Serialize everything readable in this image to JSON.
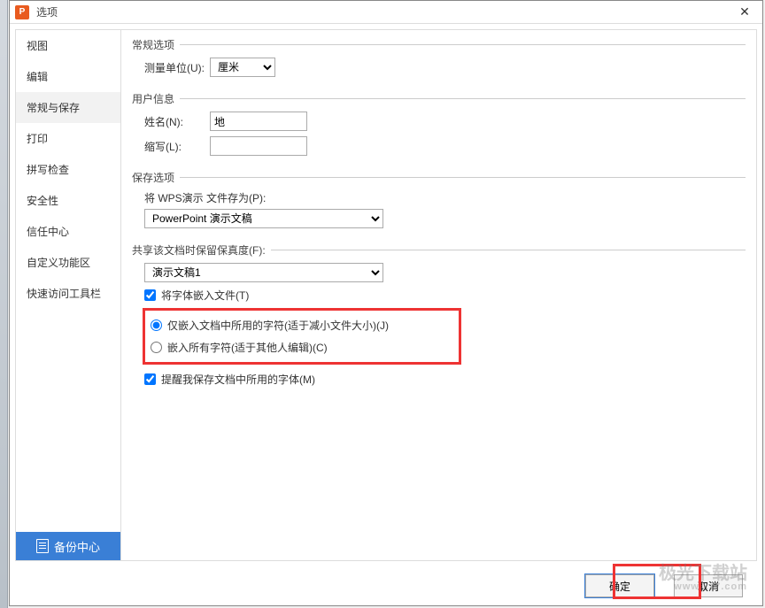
{
  "window": {
    "title": "选项"
  },
  "sidebar": {
    "items": [
      {
        "label": "视图"
      },
      {
        "label": "编辑"
      },
      {
        "label": "常规与保存",
        "selected": true
      },
      {
        "label": "打印"
      },
      {
        "label": "拼写检查"
      },
      {
        "label": "安全性"
      },
      {
        "label": "信任中心"
      },
      {
        "label": "自定义功能区"
      },
      {
        "label": "快速访问工具栏"
      }
    ],
    "backup_label": "备份中心"
  },
  "sections": {
    "general": {
      "legend": "常规选项",
      "measure_label": "测量单位(U):",
      "measure_value": "厘米"
    },
    "user": {
      "legend": "用户信息",
      "name_label": "姓名(N):",
      "name_value": "地",
      "initials_label": "缩写(L):",
      "initials_value": ""
    },
    "save": {
      "legend": "保存选项",
      "save_as_label": "将 WPS演示 文件存为(P):",
      "save_as_value": "PowerPoint 演示文稿"
    },
    "share": {
      "legend": "共享该文档时保留保真度(F):",
      "doc_value": "演示文稿1",
      "embed_fonts_label": "将字体嵌入文件(T)",
      "embed_fonts_checked": true,
      "radio_subset": "仅嵌入文档中所用的字符(适于减小文件大小)(J)",
      "radio_all": "嵌入所有字符(适于其他人编辑)(C)",
      "radio_selected": "subset",
      "remind_label": "提醒我保存文档中所用的字体(M)",
      "remind_checked": true
    }
  },
  "footer": {
    "ok": "确定",
    "cancel": "取消"
  },
  "watermark": {
    "text": "极光下载站",
    "url": "www.xz7.com"
  }
}
